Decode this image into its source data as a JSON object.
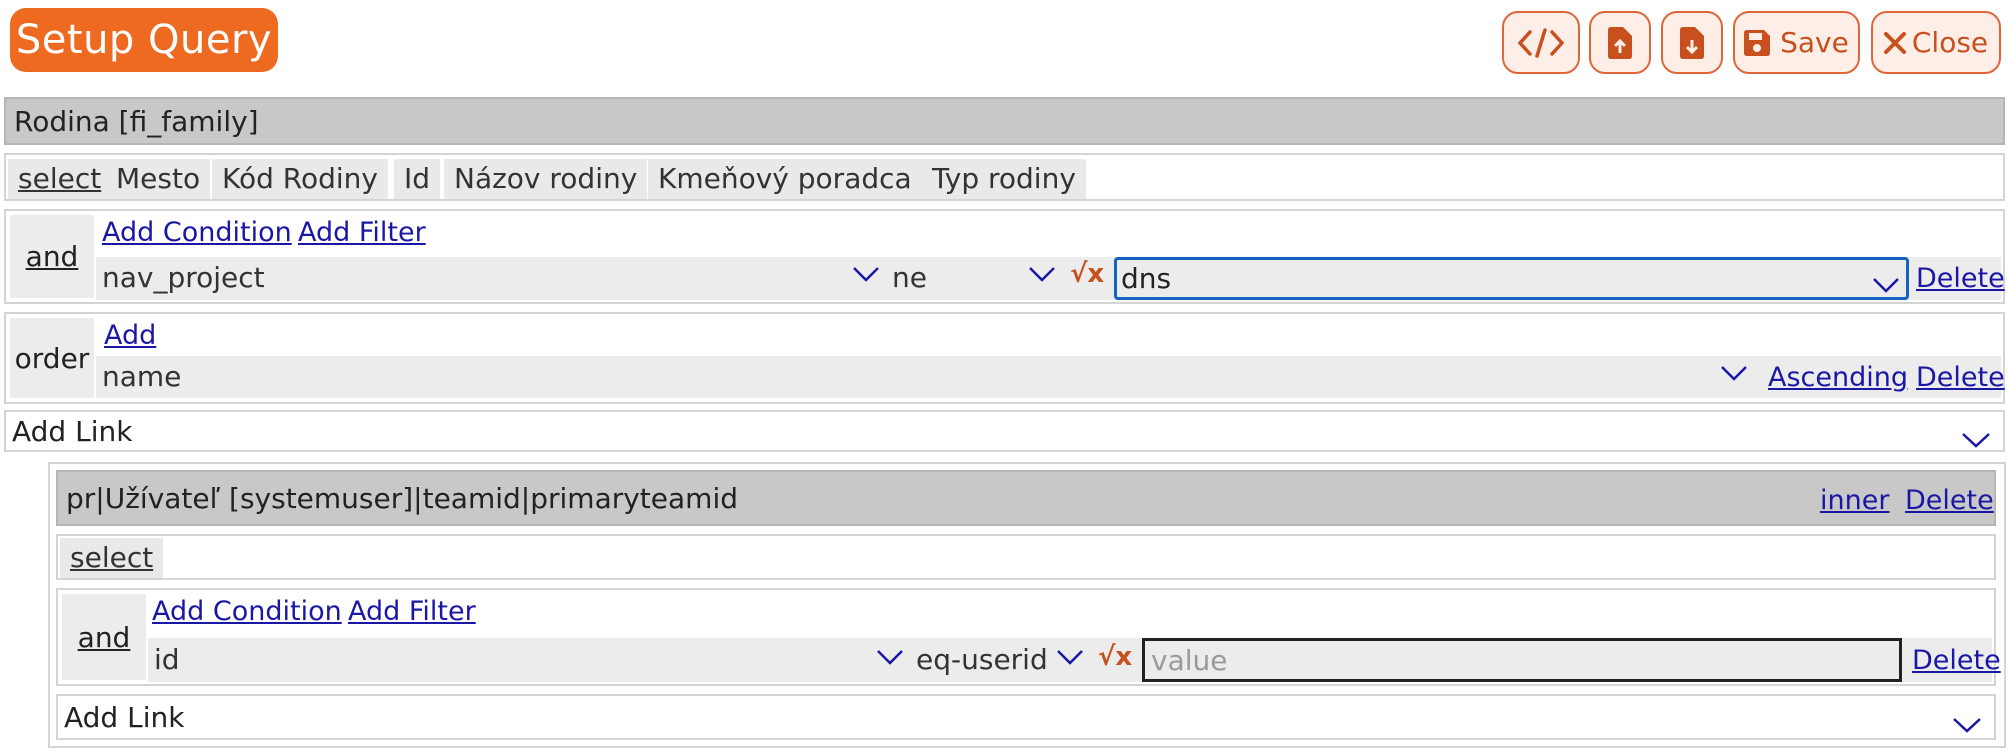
{
  "header": {
    "title": "Setup Query",
    "toolbar": {
      "code_icon": "code-icon",
      "upload_icon": "file-upload-icon",
      "download_icon": "file-download-icon",
      "save_label": "Save",
      "close_label": "Close"
    }
  },
  "entity": {
    "title": "Rodina [fi_family]",
    "select_label": "select",
    "columns": [
      "Mesto",
      "Kód Rodiny",
      "Id",
      "Názov rodiny",
      "Kmeňový poradca",
      "Typ rodiny"
    ],
    "filter": {
      "operator_label": "and",
      "add_condition": "Add Condition",
      "add_filter": "Add Filter",
      "condition": {
        "field": "nav_project",
        "op": "ne",
        "value": "dns",
        "delete": "Delete"
      }
    },
    "order": {
      "label": "order",
      "add": "Add",
      "field": "name",
      "direction": "Ascending",
      "delete": "Delete"
    },
    "add_link": "Add Link"
  },
  "link": {
    "title": "pr|Užívateľ [systemuser]|teamid|primaryteamid",
    "join": "inner",
    "delete": "Delete",
    "select_label": "select",
    "filter": {
      "operator_label": "and",
      "add_condition": "Add Condition",
      "add_filter": "Add Filter",
      "condition": {
        "field": "id",
        "op": "eq-userid",
        "value_placeholder": "value",
        "delete": "Delete"
      }
    },
    "add_link": "Add Link"
  },
  "colors": {
    "accent": "#ef6a21",
    "button_bg": "#fdefe7",
    "link": "#1a17a5",
    "focus": "#1565c0",
    "bar_bg": "#c8c8c8"
  }
}
